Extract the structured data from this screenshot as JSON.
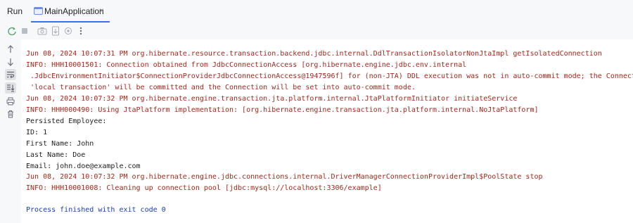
{
  "header": {
    "run_label": "Run",
    "tab": {
      "label": "MainApplication",
      "close": "×"
    }
  },
  "icons": {
    "rerun": "rerun-icon",
    "stop": "stop-icon",
    "screenshot": "camera-icon",
    "export": "export-icon",
    "settings": "settings-icon",
    "more": "more-icon",
    "up": "arrow-up-icon",
    "down": "arrow-down-icon",
    "soft_wrap": "soft-wrap-icon",
    "scroll_end": "scroll-to-end-icon",
    "print": "print-icon",
    "trash": "trash-icon"
  },
  "colors": {
    "error_text": "#a3291c",
    "normal_text": "#1f1f1f",
    "process_text": "#1a3fa8",
    "accent": "#3574f0"
  },
  "console": {
    "lines": [
      {
        "type": "err",
        "text": "Jun 08, 2024 10:07:31 PM org.hibernate.resource.transaction.backend.jdbc.internal.DdlTransactionIsolatorNonJtaImpl getIsolatedConnection"
      },
      {
        "type": "err",
        "text": "INFO: HHH10001501: Connection obtained from JdbcConnectionAccess [org.hibernate.engine.jdbc.env.internal"
      },
      {
        "type": "err",
        "text": " .JdbcEnvironmentInitiator$ConnectionProviderJdbcConnectionAccess@1947596f] for (non-JTA) DDL execution was not in auto-commit mode; the Connection"
      },
      {
        "type": "err",
        "text": " 'local transaction' will be committed and the Connection will be set into auto-commit mode."
      },
      {
        "type": "err",
        "text": "Jun 08, 2024 10:07:32 PM org.hibernate.engine.transaction.jta.platform.internal.JtaPlatformInitiator initiateService"
      },
      {
        "type": "err",
        "text": "INFO: HHH000490: Using JtaPlatform implementation: [org.hibernate.engine.transaction.jta.platform.internal.NoJtaPlatform]"
      },
      {
        "type": "out",
        "text": "Persisted Employee:"
      },
      {
        "type": "out",
        "text": "ID: 1"
      },
      {
        "type": "out",
        "text": "First Name: John"
      },
      {
        "type": "out",
        "text": "Last Name: Doe"
      },
      {
        "type": "out",
        "text": "Email: john.doe@example.com"
      },
      {
        "type": "err",
        "text": "Jun 08, 2024 10:07:32 PM org.hibernate.engine.jdbc.connections.internal.DriverManagerConnectionProviderImpl$PoolState stop"
      },
      {
        "type": "err",
        "text": "INFO: HHH10001008: Cleaning up connection pool [jdbc:mysql://localhost:3306/example]"
      },
      {
        "type": "proc",
        "text": "Process finished with exit code 0"
      }
    ]
  }
}
